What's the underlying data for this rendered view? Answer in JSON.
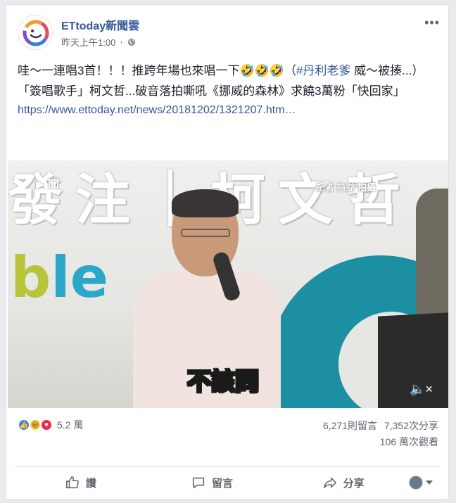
{
  "post": {
    "page_name": "ETtoday新聞雲",
    "timestamp": "昨天上午1:00",
    "privacy_icon": "globe-icon",
    "text_line1_a": "哇～一連唱3首！！！推跨年場也來唱一下🤣🤣🤣（",
    "hashtag": "#丹利老爹",
    "text_line1_b": " 威～被揍...）",
    "text_line2": "「簽唱歌手」柯文哲...破音落拍嘶吼《挪威的森林》求饒3萬粉「快回家」",
    "link": "https://www.ettoday.net/news/20181202/1321207.htm…"
  },
  "video": {
    "banner_text": "發注｜柯文哲",
    "brand_text": "ble",
    "watermark": "▶ 聞",
    "credit": "記者  詩益 拍攝",
    "caption": "不該問",
    "mute_icon": "speaker-muted-icon"
  },
  "stats": {
    "reactions": [
      "like",
      "haha",
      "love"
    ],
    "reaction_count": "5.2 萬",
    "comments": "6,271則留言",
    "shares": "7,352次分享",
    "views": "106 萬次觀看"
  },
  "actions": {
    "like": "讚",
    "comment": "留言",
    "share": "分享"
  },
  "colors": {
    "link": "#365899",
    "like_blue": "#3b82f6",
    "love_red": "#f0284a",
    "haha_yellow": "#f7c948"
  }
}
